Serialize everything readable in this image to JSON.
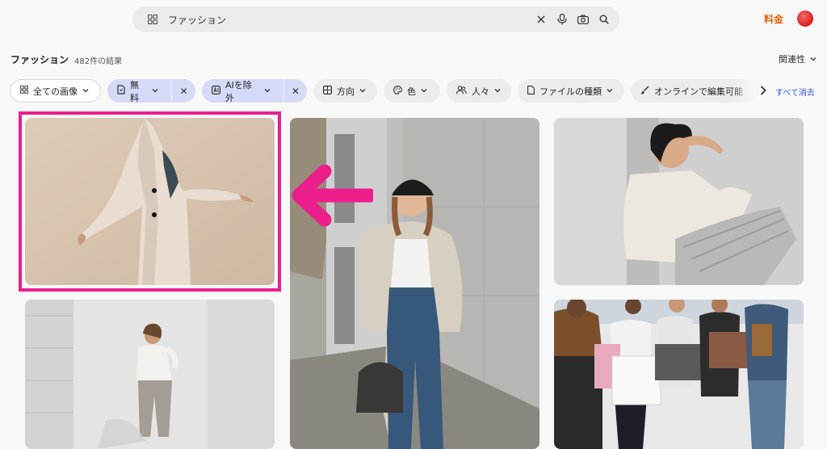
{
  "search": {
    "query": "ファッション"
  },
  "header": {
    "price_link": "料金"
  },
  "results": {
    "title": "ファッション",
    "count": "482件の結果",
    "sort_label": "関連性"
  },
  "filters": [
    {
      "label": "全ての画像",
      "style": "outline"
    },
    {
      "label": "無料",
      "style": "active"
    },
    {
      "label": "AIを除外",
      "style": "active"
    },
    {
      "label": "方向",
      "style": "default"
    },
    {
      "label": "色",
      "style": "default"
    },
    {
      "label": "人々",
      "style": "default"
    },
    {
      "label": "ファイルの種類",
      "style": "default"
    },
    {
      "label": "オンラインで編集可能",
      "style": "default"
    }
  ],
  "clear_all": "すべて消去",
  "colors": {
    "accent_orange": "#e0640e",
    "chip_active_bg": "#d7daf7",
    "clear_link": "#3553d8",
    "highlight_pink": "#ec1e8c"
  },
  "images": [
    {
      "subject": "woman in beige blazer, arms outstretched"
    },
    {
      "subject": "woman in cap and denim by concrete wall"
    },
    {
      "subject": "woman in white shirt and pleated skirt"
    },
    {
      "subject": "woman in white outfit by white door"
    },
    {
      "subject": "group of people holding shopping bags"
    }
  ]
}
